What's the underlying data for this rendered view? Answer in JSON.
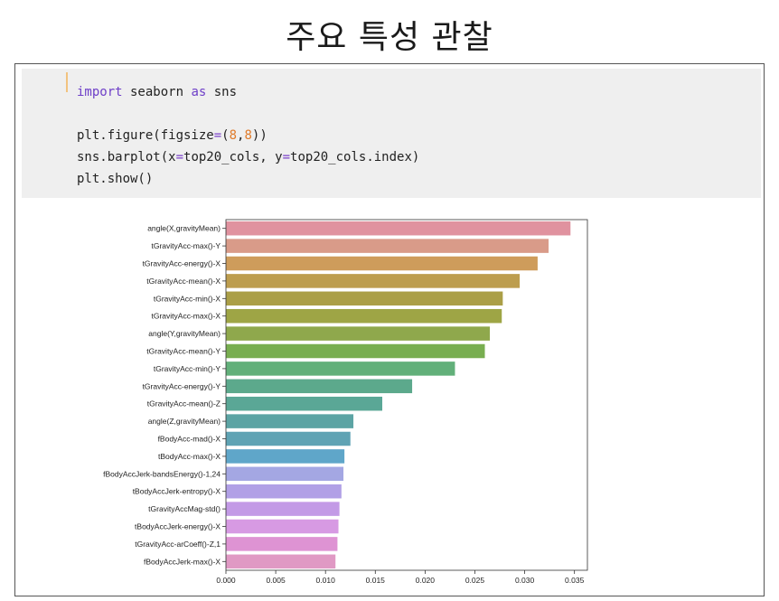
{
  "slide": {
    "title": "주요 특성 관찰"
  },
  "code": {
    "line1": {
      "kw1": "import",
      "mid": " seaborn ",
      "kw2": "as",
      "end": " sns"
    },
    "line3": "plt.figure(figsize=(8,8))",
    "line4": "sns.barplot(x=top20_cols, y=top20_cols.index)",
    "line5": "plt.show()"
  },
  "chart_data": {
    "type": "bar",
    "orientation": "horizontal",
    "categories": [
      "angle(X,gravityMean)",
      "tGravityAcc-max()-Y",
      "tGravityAcc-energy()-X",
      "tGravityAcc-mean()-X",
      "tGravityAcc-min()-X",
      "tGravityAcc-max()-X",
      "angle(Y,gravityMean)",
      "tGravityAcc-mean()-Y",
      "tGravityAcc-min()-Y",
      "tGravityAcc-energy()-Y",
      "tGravityAcc-mean()-Z",
      "angle(Z,gravityMean)",
      "fBodyAcc-mad()-X",
      "tBodyAcc-max()-X",
      "fBodyAccJerk-bandsEnergy()-1,24",
      "tBodyAccJerk-entropy()-X",
      "tGravityAccMag-std()",
      "tBodyAccJerk-energy()-X",
      "tGravityAcc-arCoeff()-Z,1",
      "fBodyAccJerk-max()-X"
    ],
    "values": [
      0.0346,
      0.0324,
      0.0313,
      0.0295,
      0.0278,
      0.0277,
      0.0265,
      0.026,
      0.023,
      0.0187,
      0.0157,
      0.0128,
      0.0125,
      0.0119,
      0.0118,
      0.0116,
      0.0114,
      0.0113,
      0.0112,
      0.011
    ],
    "colors": [
      "#e0929f",
      "#d99b89",
      "#ce9c5b",
      "#bd9d4e",
      "#ab9f47",
      "#9ea545",
      "#8fa84c",
      "#78ae50",
      "#62b07a",
      "#5ca98c",
      "#5aa796",
      "#5ca4a4",
      "#5fa3b4",
      "#5fa6c9",
      "#a4a7e3",
      "#b1a0e6",
      "#c39ae6",
      "#d79ae3",
      "#de93d3",
      "#e099c4"
    ],
    "xticks": [
      "0.000",
      "0.005",
      "0.010",
      "0.015",
      "0.020",
      "0.025",
      "0.030",
      "0.035"
    ],
    "xlim": [
      0,
      0.0363
    ]
  }
}
